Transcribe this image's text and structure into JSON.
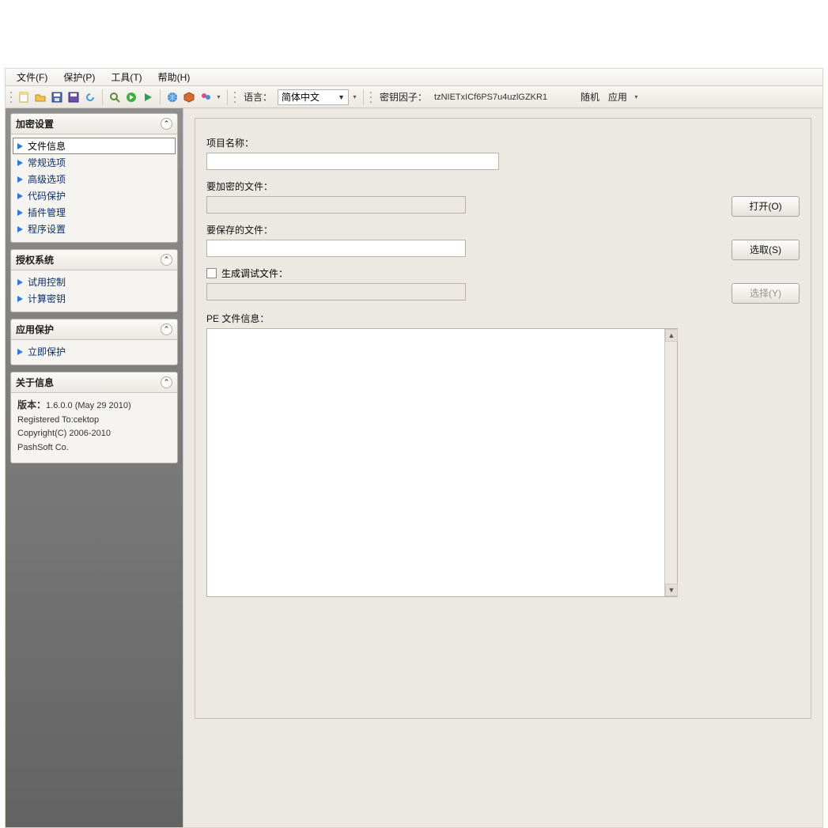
{
  "menu": {
    "file": "文件(F)",
    "protect": "保护(P)",
    "tools": "工具(T)",
    "help": "帮助(H)"
  },
  "toolbar": {
    "language_label": "语言：",
    "language_value": "简体中文",
    "keyfactor_label": "密钥因子：",
    "keyfactor_value": "tzNIETxICf6PS7u4uzlGZKR1",
    "random_btn": "随机",
    "apply_btn": "应用"
  },
  "sidebar": {
    "panels": {
      "encrypt": {
        "title": "加密设置",
        "items": [
          "文件信息",
          "常规选项",
          "高级选项",
          "代码保护",
          "插件管理",
          "程序设置"
        ]
      },
      "license": {
        "title": "授权系统",
        "items": [
          "试用控制",
          "计算密钥"
        ]
      },
      "appprotect": {
        "title": "应用保护",
        "items": [
          "立即保护"
        ]
      },
      "about": {
        "title": "关于信息",
        "version_label": "版本：",
        "version_value": "1.6.0.0 (May 29 2010)",
        "registered": "Registered To:cektop",
        "copyright1": "Copyright(C) 2006-2010",
        "copyright2": "PashSoft Co."
      }
    }
  },
  "main": {
    "project_name_label": "项目名称：",
    "file_to_encrypt_label": "要加密的文件：",
    "open_btn": "打开(O)",
    "file_to_save_label": "要保存的文件：",
    "select_btn": "选取(S)",
    "gen_debug_label": "生成调试文件：",
    "choose_btn": "选择(Y)",
    "pe_info_label": "PE 文件信息："
  }
}
